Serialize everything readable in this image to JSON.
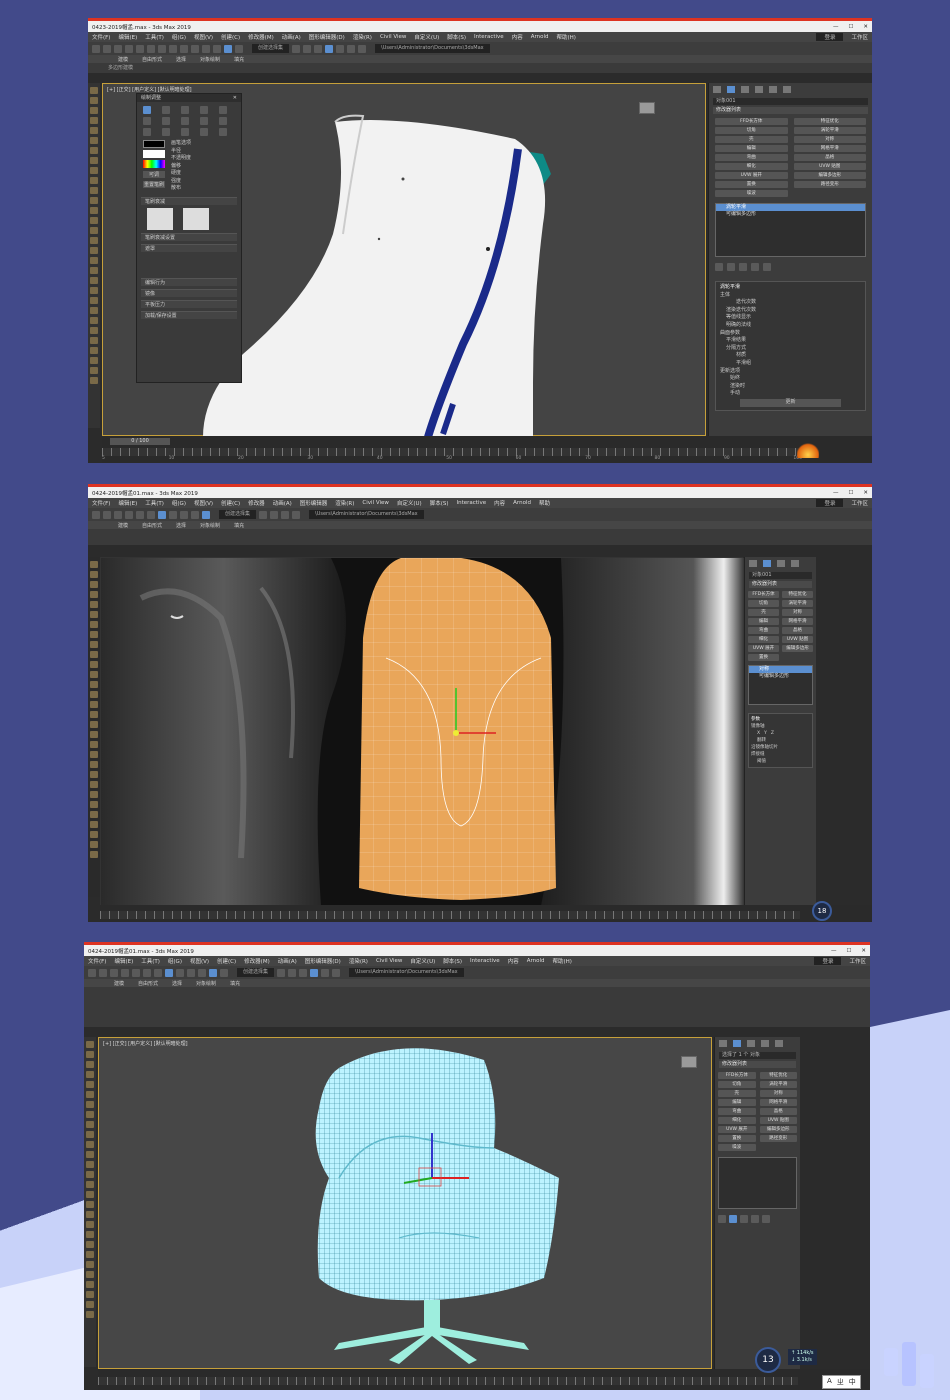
{
  "menu": [
    "文件(F)",
    "编辑(E)",
    "工具(T)",
    "组(G)",
    "视图(V)",
    "创建(C)",
    "修改器(M)",
    "动画(A)",
    "图形编辑器(D)",
    "渲染(R)",
    "Civil View",
    "自定义(U)",
    "脚本(S)",
    "Interactive",
    "内容",
    "Arnold",
    "帮助(H)"
  ],
  "menu_short": [
    "文件(F)",
    "编辑(E)",
    "工具(T)",
    "组(G)",
    "视图(V)",
    "创建(C)",
    "修改器",
    "动画(A)",
    "图形编辑器",
    "渲染(R)",
    "Civil View",
    "自定义(U)",
    "脚本(S)",
    "Interactive",
    "内容",
    "Arnold",
    "帮助"
  ],
  "window_controls": [
    "—",
    "☐",
    "✕"
  ],
  "shots": [
    {
      "title": "0423-2019帽孟.max - 3ds Max 2019",
      "search": "登录",
      "workspace": "工作区",
      "selection_set": "创建选择集",
      "path": "\\Users\\Administrator\\Documents\\3dsMax",
      "ribbon": [
        "建模",
        "自由形式",
        "选择",
        "对象绘制",
        "填充"
      ],
      "ribbon_sub": "多边形建模",
      "viewport_label": "[+] [正交] [用户定义] [默认明暗处理]",
      "frame": "0 / 100",
      "time_marks": [
        "5",
        "10",
        "20",
        "30",
        "40",
        "50",
        "60",
        "70",
        "80",
        "90",
        "100"
      ],
      "float_panel": {
        "title": "绘制调整",
        "fields": [
          "画笔选项",
          "半径",
          "不透明度",
          "偏移",
          "硬度",
          "强度",
          "散布"
        ],
        "sections": [
          "笔刷衰减",
          "笔刷衰减设置",
          "遮罩",
          "编辑行为",
          "镜像",
          "平板压力",
          "加载/保存设置"
        ],
        "buttons": [
          "可调",
          "重置笔刷"
        ]
      },
      "cmd": {
        "object_name": "对象001",
        "list_label": "修改器列表",
        "buttons": [
          "FFD长方体",
          "特征优化",
          "切角",
          "涡轮平滑",
          "壳",
          "对称",
          "编辑",
          "网格平滑",
          "弯曲",
          "晶格",
          "细化",
          "UVW 贴图",
          "UVW 展开",
          "编辑多边形",
          "置换",
          "路径变形",
          "噪波"
        ],
        "stack": [
          "涡轮平滑",
          "可编辑多边形"
        ],
        "rollout_title": "涡轮平滑",
        "rollout_items": [
          "主体",
          "迭代次数",
          "渲染迭代次数",
          "等值线显示",
          "明确的法线",
          "曲面参数",
          "平滑结果",
          "分隔方式",
          "材质",
          "平滑组",
          "更新选项",
          "始终",
          "渲染时",
          "手动",
          "更新"
        ]
      }
    },
    {
      "title": "0424-2019帽孟01.max - 3ds Max 2019",
      "search": "登录",
      "workspace": "工作区",
      "selection_set": "创建选择集",
      "path": "\\Users\\Administrator\\Documents\\3dsMax",
      "ribbon": [
        "建模",
        "自由形式",
        "选择",
        "对象绘制",
        "填充"
      ],
      "viewport_label": "[+] [顶] [用户定义] [默认明暗处理]",
      "frame": "0 / 100",
      "badge": "18",
      "cmd": {
        "object_name": "对象001",
        "list_label": "修改器列表",
        "buttons": [
          "FFD长方体",
          "特征优化",
          "切角",
          "涡轮平滑",
          "壳",
          "对称",
          "编辑",
          "网格平滑",
          "弯曲",
          "晶格",
          "细化",
          "UVW 贴图",
          "UVW 展开",
          "编辑多边形",
          "置换"
        ],
        "stack": [
          "对称",
          "可编辑多边形"
        ],
        "rollout_title": "参数",
        "rollout_items": [
          "镜像轴",
          "X",
          "Y",
          "Z",
          "翻转",
          "沿镜像轴切片",
          "焊接缝",
          "阈值"
        ]
      }
    },
    {
      "title": "0424-2019帽孟01.max - 3ds Max 2019",
      "search": "登录",
      "workspace": "工作区",
      "selection_set": "创建选择集",
      "path": "\\Users\\Administrator\\Documents\\3dsMax",
      "ribbon": [
        "建模",
        "自由形式",
        "选择",
        "对象绘制",
        "填充"
      ],
      "viewport_label": "[+] [正交] [用户定义] [默认明暗处理]",
      "frame": "0 / 100",
      "badge": "13",
      "speed_up": "↑ 114k/s",
      "speed_down": "↓ 3.1k/s",
      "ime": [
        "A",
        "ㄓ",
        "中"
      ],
      "cmd": {
        "object_name": "选择了 1 个 对象",
        "list_label": "修改器列表",
        "buttons": [
          "FFD长方体",
          "特征优化",
          "切角",
          "涡轮平滑",
          "壳",
          "对称",
          "编辑",
          "网格平滑",
          "弯曲",
          "晶格",
          "细化",
          "UVW 贴图",
          "UVW 展开",
          "编辑多边形",
          "置换",
          "路径变形",
          "噪波"
        ],
        "stack": []
      }
    }
  ],
  "colors": {
    "page_bg": "#424a8a",
    "viewport_border": "#c6a03a",
    "chair_shell": "#f2f2f2",
    "chair_stripe": "#1a2a8a",
    "chair_teal": "#0e8a86",
    "mesh_orange": "#e9a65a",
    "wireframe_cyan": "#b9f4ff"
  }
}
